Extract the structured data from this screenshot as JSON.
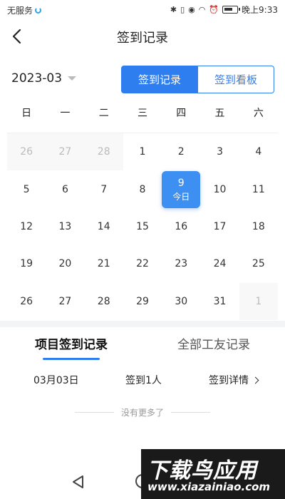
{
  "status_bar": {
    "carrier": "无服务",
    "time": "晚上9:33",
    "icons": [
      "bluetooth-icon",
      "vibrate-icon",
      "eye-icon",
      "wifi-icon",
      "alarm-icon",
      "battery-icon"
    ],
    "battery_level": 0.7
  },
  "nav": {
    "title": "签到记录",
    "back_icon": "chevron-left-icon"
  },
  "month_picker": {
    "value": "2023-03"
  },
  "view_toggle": {
    "options": [
      "签到记录",
      "签到看板"
    ],
    "selected": "签到记录",
    "accent_color": "#2e7ef0"
  },
  "calendar": {
    "weekdays": [
      "日",
      "一",
      "二",
      "三",
      "四",
      "五",
      "六"
    ],
    "today_label": "今日",
    "weeks": [
      [
        {
          "d": "26",
          "muted": true
        },
        {
          "d": "27",
          "muted": true
        },
        {
          "d": "28",
          "muted": true
        },
        {
          "d": "1"
        },
        {
          "d": "2"
        },
        {
          "d": "3"
        },
        {
          "d": "4"
        }
      ],
      [
        {
          "d": "5"
        },
        {
          "d": "6"
        },
        {
          "d": "7"
        },
        {
          "d": "8"
        },
        {
          "d": "9",
          "today": true
        },
        {
          "d": "10"
        },
        {
          "d": "11"
        }
      ],
      [
        {
          "d": "12"
        },
        {
          "d": "13"
        },
        {
          "d": "14"
        },
        {
          "d": "15"
        },
        {
          "d": "16"
        },
        {
          "d": "17"
        },
        {
          "d": "18"
        }
      ],
      [
        {
          "d": "19"
        },
        {
          "d": "20"
        },
        {
          "d": "21"
        },
        {
          "d": "22"
        },
        {
          "d": "23"
        },
        {
          "d": "24"
        },
        {
          "d": "25"
        }
      ],
      [
        {
          "d": "26"
        },
        {
          "d": "27"
        },
        {
          "d": "28"
        },
        {
          "d": "29"
        },
        {
          "d": "30"
        },
        {
          "d": "31"
        },
        {
          "d": "1",
          "muted": true
        }
      ]
    ]
  },
  "tabs": [
    {
      "label": "项目签到记录",
      "active": true
    },
    {
      "label": "全部工友记录",
      "active": false
    }
  ],
  "records": [
    {
      "date": "03月03日",
      "count": "签到1人",
      "detail": "签到详情"
    }
  ],
  "no_more_text": "没有更多了",
  "system_nav": {
    "back_icon": "triangle-back-icon",
    "home_icon": "circle-home-icon"
  },
  "watermark": {
    "title": "下载鸟应用",
    "url": "www.xiazainiao.com"
  }
}
